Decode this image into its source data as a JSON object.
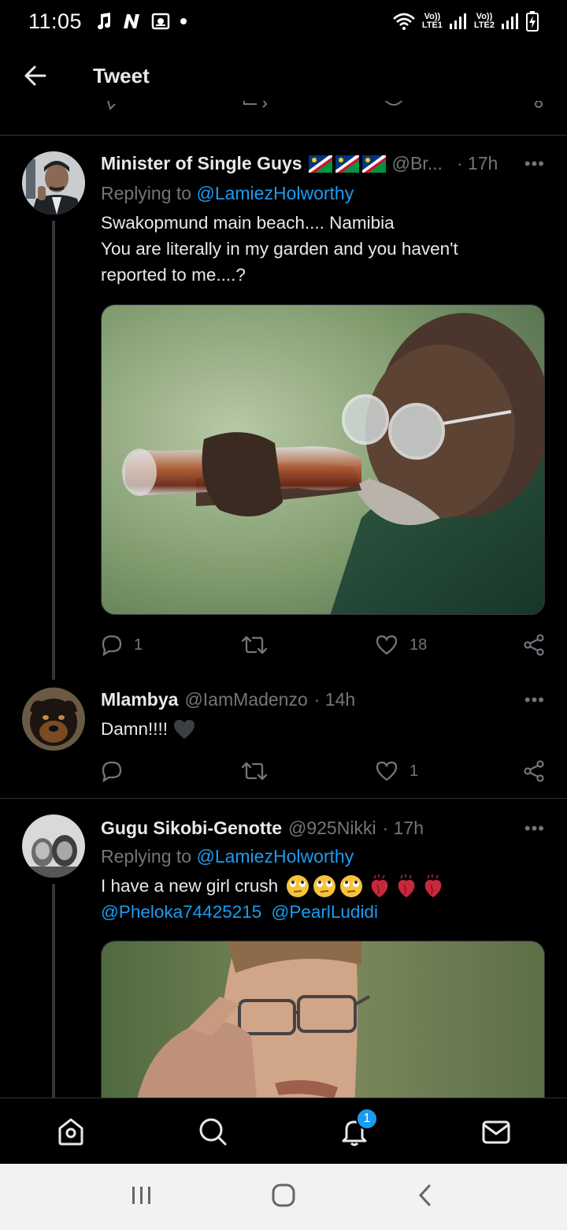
{
  "status_bar": {
    "time": "11:05",
    "lte1_label": "Vo))\nLTE1",
    "lte2_label": "Vo))\nLTE2"
  },
  "header": {
    "title": "Tweet"
  },
  "tweets": [
    {
      "name": "Minister of Single Guys",
      "handle": "@Br...",
      "time": "· 17h",
      "replying_prefix": "Replying to ",
      "replying_to": "@LamiezHolworthy",
      "text_line1": "Swakopmund main beach.... Namibia",
      "text_line2": "You are literally in my garden and you haven't",
      "text_line3": "reported to me....?",
      "replies": "1",
      "retweets": "",
      "likes": "18"
    },
    {
      "name": "Mlambya",
      "handle": "@IamMadenzo",
      "time": "· 14h",
      "text": "Damn!!!!",
      "replies": "",
      "retweets": "",
      "likes": "1"
    },
    {
      "name": "Gugu Sikobi-Genotte",
      "handle": "@925Nikki",
      "time": "· 17h",
      "replying_prefix": "Replying to ",
      "replying_to": "@LamiezHolworthy",
      "text_line1": "I have a new girl crush",
      "mention1": "@Pheloka74425215",
      "mention2": "@PearlLudidi"
    }
  ],
  "nav": {
    "notifications_badge": "1"
  },
  "colors": {
    "accent": "#1d9bf0",
    "background": "#000000",
    "muted": "#71767b"
  }
}
